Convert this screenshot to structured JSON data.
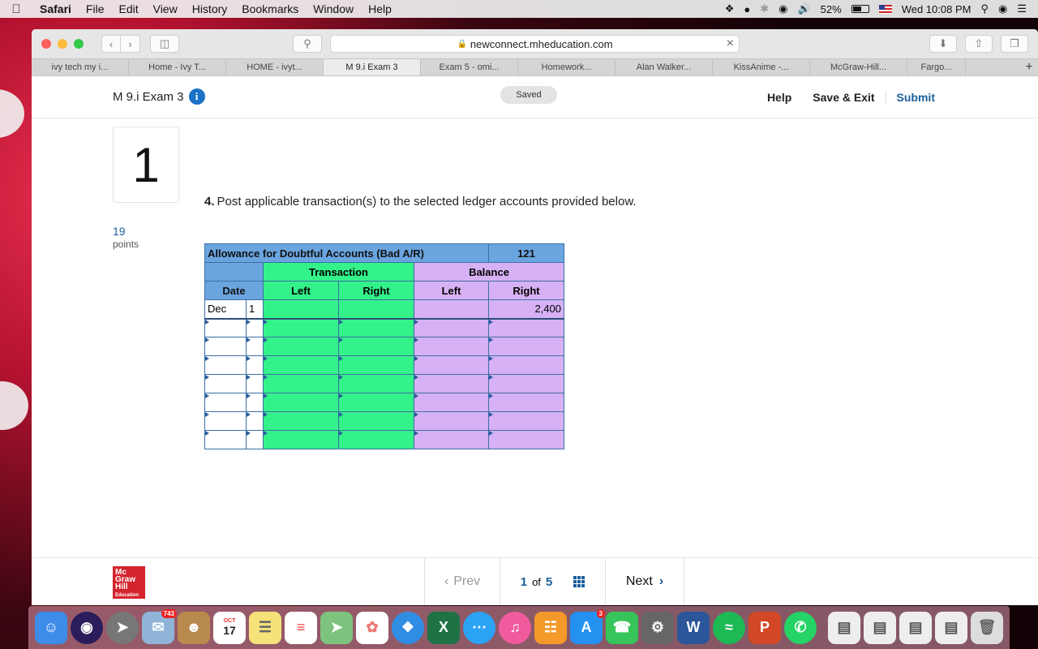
{
  "menubar": {
    "app": "Safari",
    "items": [
      "File",
      "Edit",
      "View",
      "History",
      "Bookmarks",
      "Window",
      "Help"
    ],
    "battery": "52%",
    "clock": "Wed 10:08 PM"
  },
  "browser": {
    "url": "newconnect.mheducation.com",
    "tabs": [
      "ivy tech my i...",
      "Home - Ivy T...",
      "HOME - ivyt...",
      "M 9.i Exam 3",
      "Exam 5 - omi...",
      "Homework...",
      "Alan Walker...",
      "KissAnime -...",
      "McGraw-Hill...",
      "Fargo..."
    ],
    "active_tab": 3
  },
  "header": {
    "title": "M 9.i Exam 3",
    "saved": "Saved",
    "help": "Help",
    "save_exit": "Save & Exit",
    "submit": "Submit"
  },
  "question": {
    "number": "1",
    "points_value": "19",
    "points_label": "points",
    "index": "4.",
    "text": "Post applicable transaction(s) to the selected ledger accounts provided below."
  },
  "ledger": {
    "account_name": "Allowance for Doubtful Accounts (Bad A/R)",
    "account_number": "121",
    "transaction_header": "Transaction",
    "balance_header": "Balance",
    "date_header": "Date",
    "left": "Left",
    "right": "Right",
    "first_row": {
      "month": "Dec",
      "day": "1",
      "balance_right": "2,400"
    }
  },
  "footer": {
    "logo": [
      "Mc",
      "Graw",
      "Hill",
      "Education"
    ],
    "prev": "Prev",
    "current": "1",
    "of": "of",
    "total": "5",
    "next": "Next"
  },
  "dock": {
    "mail_badge": "743",
    "calendar_month": "OCT",
    "calendar_day": "17",
    "appstore_badge": "3"
  }
}
